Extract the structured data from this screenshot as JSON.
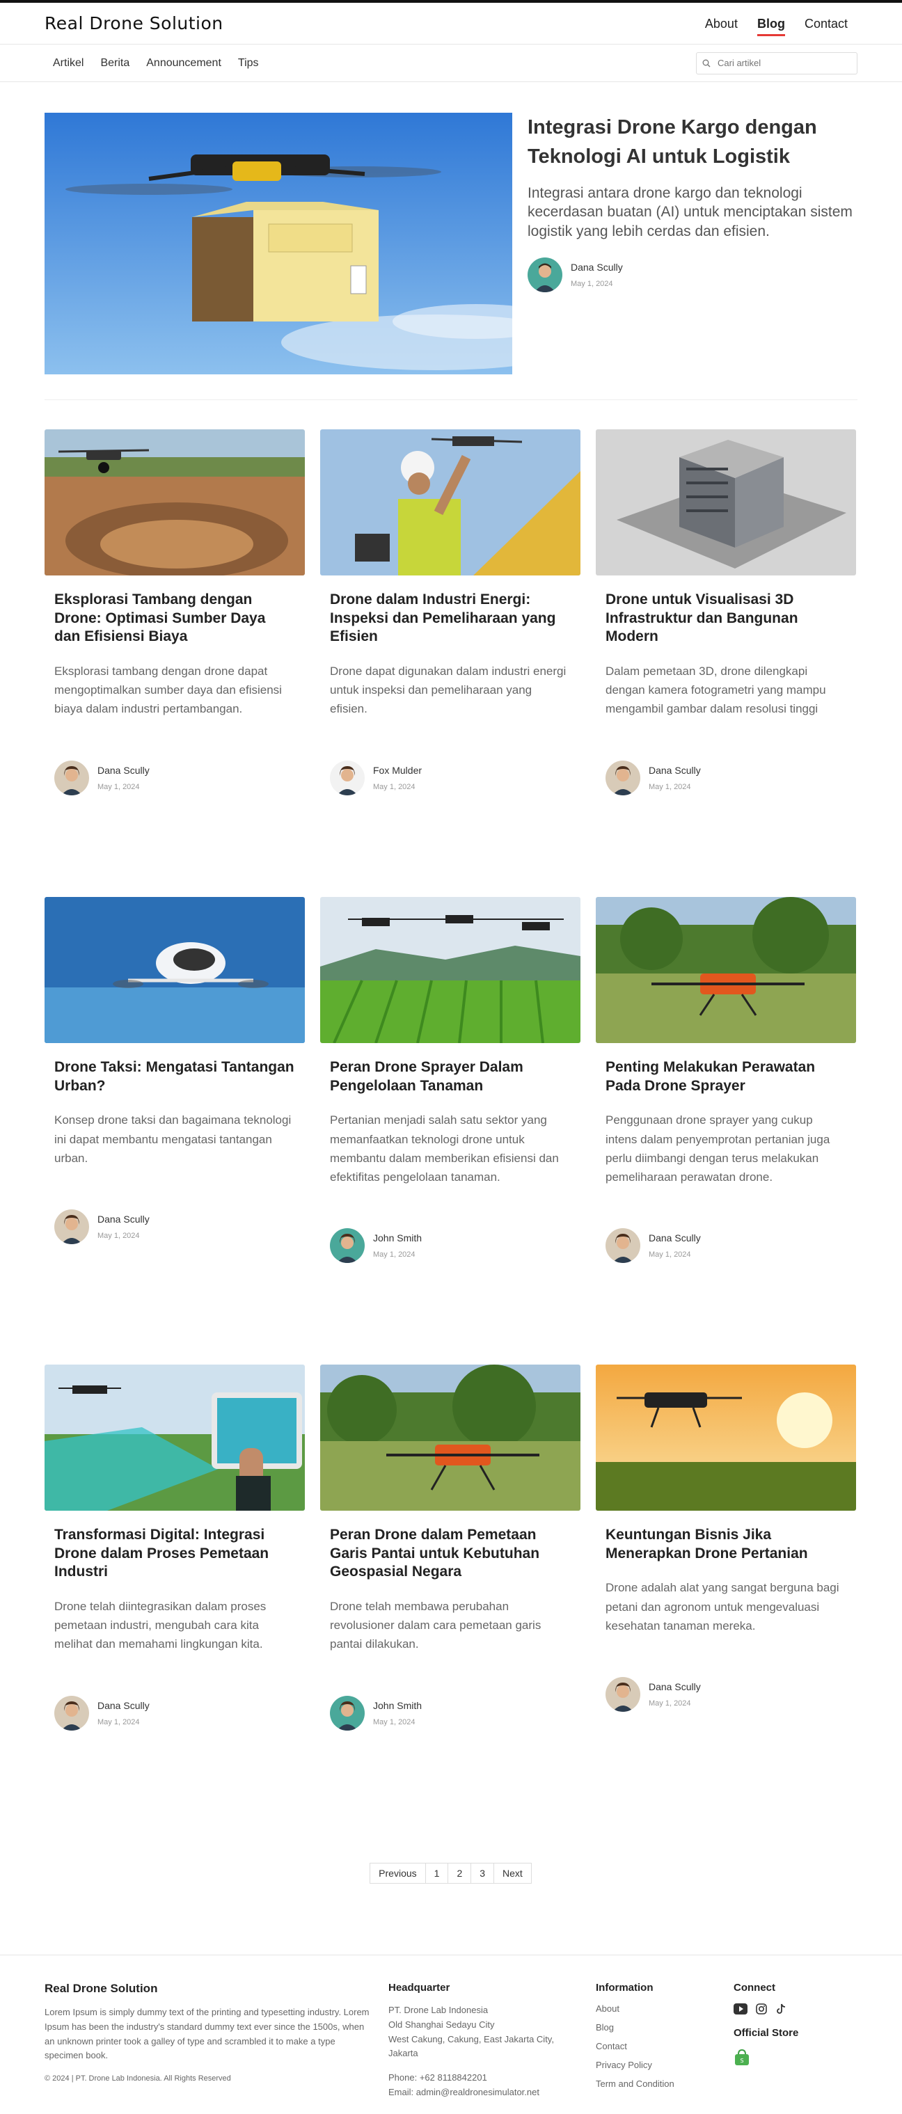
{
  "header": {
    "logo": "Real Drone Solution",
    "nav": [
      "About",
      "Blog",
      "Contact"
    ],
    "active": "Blog"
  },
  "subnav": {
    "categories": [
      "Artikel",
      "Berita",
      "Announcement",
      "Tips"
    ],
    "search_placeholder": "Cari artikel"
  },
  "featured": {
    "title": "Integrasi Drone Kargo dengan Teknologi AI untuk Logistik",
    "excerpt": "Integrasi antara drone kargo dan teknologi kecerdasan buatan (AI) untuk menciptakan sistem logistik yang lebih cerdas dan efisien.",
    "author": "Dana Scully",
    "date": "May 1, 2024"
  },
  "posts": [
    {
      "title": "Eksplorasi Tambang dengan Drone: Optimasi Sumber Daya dan Efisiensi Biaya",
      "excerpt": "Eksplorasi tambang dengan drone dapat mengoptimalkan sumber daya dan efisiensi biaya dalam industri pertambangan.",
      "author": "Dana Scully",
      "date": "May 1, 2024"
    },
    {
      "title": "Drone dalam Industri Energi: Inspeksi dan Pemeliharaan yang Efisien",
      "excerpt": "Drone dapat digunakan dalam industri energi untuk inspeksi dan pemeliharaan yang efisien.",
      "author": "Fox Mulder",
      "date": "May 1, 2024"
    },
    {
      "title": "Drone untuk Visualisasi 3D Infrastruktur dan Bangunan Modern",
      "excerpt": "Dalam pemetaan 3D, drone dilengkapi dengan kamera fotogrametri yang mampu mengambil gambar dalam resolusi tinggi",
      "author": "Dana Scully",
      "date": "May 1, 2024"
    },
    {
      "title": "Drone Taksi: Mengatasi Tantangan Urban?",
      "excerpt": "Konsep drone taksi dan bagaimana teknologi ini dapat membantu mengatasi tantangan urban.",
      "author": "Dana Scully",
      "date": "May 1, 2024"
    },
    {
      "title": "Peran Drone Sprayer Dalam Pengelolaan Tanaman",
      "excerpt": "Pertanian menjadi salah satu sektor yang memanfaatkan teknologi drone untuk membantu dalam memberikan efisiensi dan efektifitas pengelolaan tanaman.",
      "author": "John Smith",
      "date": "May 1, 2024"
    },
    {
      "title": "Penting Melakukan Perawatan Pada Drone Sprayer",
      "excerpt": "Penggunaan drone sprayer yang cukup intens dalam penyemprotan pertanian juga perlu diimbangi dengan terus melakukan pemeliharaan perawatan drone.",
      "author": "Dana Scully",
      "date": "May 1, 2024"
    },
    {
      "title": "Transformasi Digital: Integrasi Drone dalam Proses Pemetaan Industri",
      "excerpt": "Drone telah diintegrasikan dalam proses pemetaan industri, mengubah cara kita melihat dan memahami lingkungan kita.",
      "author": "Dana Scully",
      "date": "May 1, 2024"
    },
    {
      "title": "Peran Drone dalam Pemetaan Garis Pantai untuk Kebutuhan Geospasial Negara",
      "excerpt": "Drone telah membawa perubahan revolusioner dalam cara pemetaan garis pantai dilakukan.",
      "author": "John Smith",
      "date": "May 1, 2024"
    },
    {
      "title": "Keuntungan Bisnis Jika Menerapkan Drone Pertanian",
      "excerpt": "Drone adalah alat yang sangat berguna bagi petani dan agronom untuk mengevaluasi kesehatan tanaman mereka.",
      "author": "Dana Scully",
      "date": "May 1, 2024"
    }
  ],
  "pagination": [
    "Previous",
    "1",
    "2",
    "3",
    "Next"
  ],
  "footer": {
    "brand": "Real Drone Solution",
    "about": "Lorem Ipsum is simply dummy text of the printing and typesetting industry. Lorem Ipsum has been the industry's standard dummy text ever since the 1500s, when an unknown printer took a galley of type and scrambled it to make a type specimen book.",
    "copyright": "© 2024 | PT. Drone Lab Indonesia. All Rights Reserved",
    "hq_title": "Headquarter",
    "hq_lines": [
      "PT. Drone Lab Indonesia",
      "Old Shanghai Sedayu City",
      "West Cakung, Cakung, East Jakarta City, Jakarta"
    ],
    "phone": "Phone: +62 8118842201",
    "email": "Email: admin@realdronesimulator.net",
    "info_title": "Information",
    "info_links": [
      "About",
      "Blog",
      "Contact",
      "Privacy Policy",
      "Term and Condition"
    ],
    "connect_title": "Connect",
    "social_icons": [
      "youtube-icon",
      "instagram-icon",
      "tiktok-icon"
    ],
    "store_title": "Official Store",
    "store_icon": "shopping-bag-icon"
  }
}
